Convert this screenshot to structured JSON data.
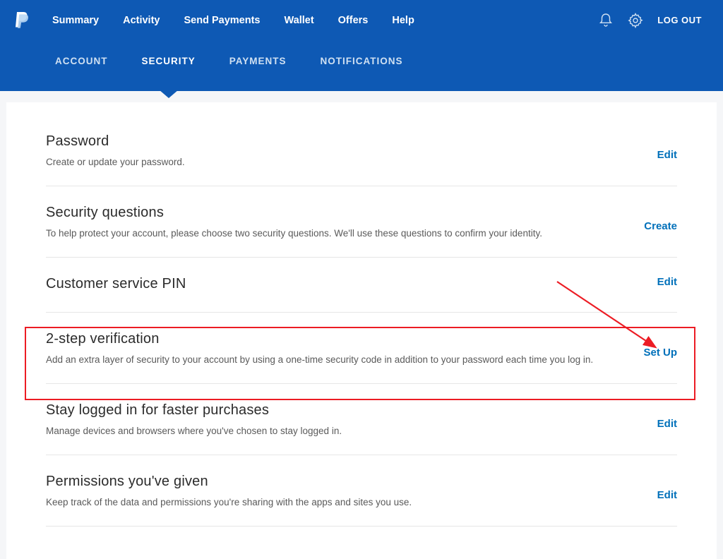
{
  "topnav": {
    "items": [
      "Summary",
      "Activity",
      "Send Payments",
      "Wallet",
      "Offers",
      "Help"
    ],
    "logout": "LOG OUT"
  },
  "subnav": {
    "items": [
      "ACCOUNT",
      "SECURITY",
      "PAYMENTS",
      "NOTIFICATIONS"
    ],
    "active_index": 1
  },
  "sections": [
    {
      "title": "Password",
      "desc": "Create or update your password.",
      "action": "Edit"
    },
    {
      "title": "Security questions",
      "desc": "To help protect your account, please choose two security questions. We'll use these questions to confirm your identity.",
      "action": "Create"
    },
    {
      "title": "Customer service PIN",
      "desc": "",
      "action": "Edit"
    },
    {
      "title": "2-step verification",
      "desc": "Add an extra layer of security to your account by using a one-time security code in addition to your password each time you log in.",
      "action": "Set Up"
    },
    {
      "title": "Stay logged in for faster purchases",
      "desc": "Manage devices and browsers where you've chosen to stay logged in.",
      "action": "Edit"
    },
    {
      "title": "Permissions you've given",
      "desc": "Keep track of the data and permissions you're sharing with the apps and sites you use.",
      "action": "Edit"
    }
  ],
  "annotation": {
    "highlight_section_index": 3
  }
}
